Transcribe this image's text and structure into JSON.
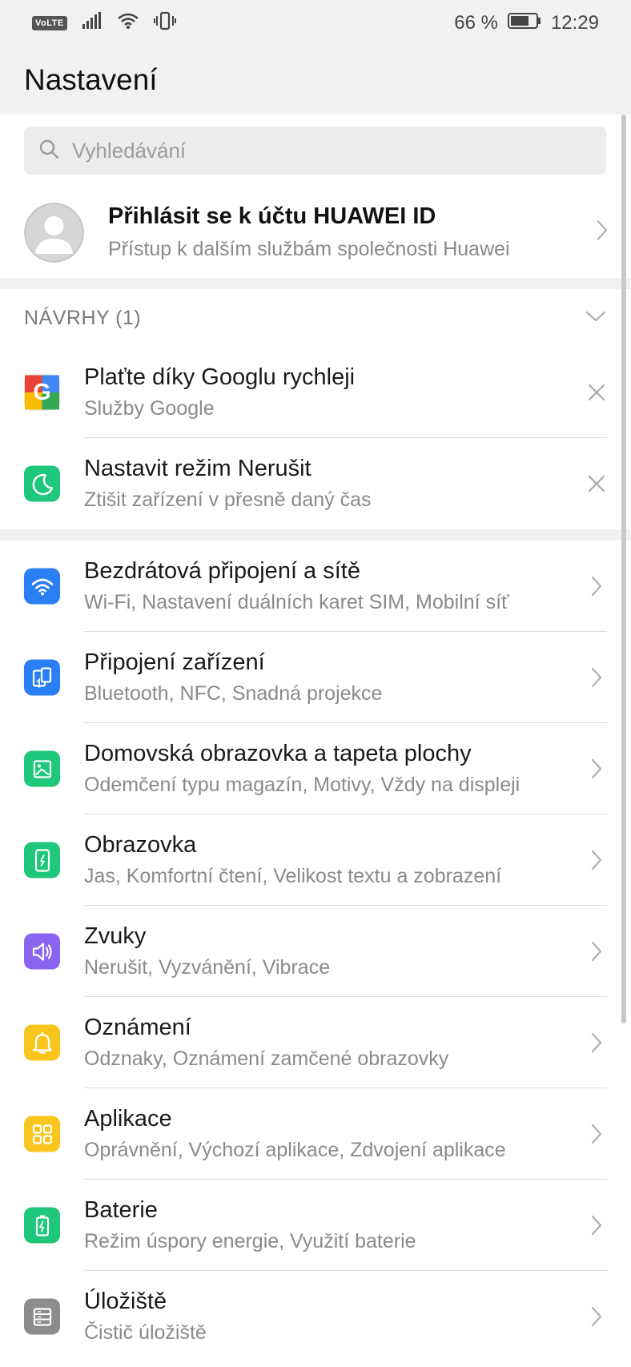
{
  "status_bar": {
    "volte": "VoLTE",
    "battery_percent": "66 %",
    "time": "12:29"
  },
  "header": {
    "title": "Nastavení"
  },
  "search": {
    "placeholder": "Vyhledávání"
  },
  "account": {
    "title": "Přihlásit se k účtu HUAWEI ID",
    "subtitle": "Přístup k dalším službám společnosti Huawei"
  },
  "suggestions": {
    "title": "NÁVRHY (1)",
    "items": [
      {
        "title": "Plaťte díky Googlu rychleji",
        "subtitle": "Služby Google",
        "icon": "google-icon"
      },
      {
        "title": "Nastavit režim Nerušit",
        "subtitle": "Ztišit zařízení v přesně daný čas",
        "icon": "moon-icon"
      }
    ]
  },
  "settings": {
    "items": [
      {
        "title": "Bezdrátová připojení a sítě",
        "subtitle": "Wi-Fi, Nastavení duálních karet SIM, Mobilní síť",
        "icon": "wifi-icon",
        "color": "#2a7ff5"
      },
      {
        "title": "Připojení zařízení",
        "subtitle": "Bluetooth, NFC, Snadná projekce",
        "icon": "device-connection-icon",
        "color": "#2a7ff5"
      },
      {
        "title": "Domovská obrazovka a tapeta plochy",
        "subtitle": "Odemčení typu magazín, Motivy, Vždy na displeji",
        "icon": "wallpaper-icon",
        "color": "#1fc77a"
      },
      {
        "title": "Obrazovka",
        "subtitle": "Jas, Komfortní čtení, Velikost textu a zobrazení",
        "icon": "display-icon",
        "color": "#1fc77a"
      },
      {
        "title": "Zvuky",
        "subtitle": "Nerušit, Vyzvánění, Vibrace",
        "icon": "speaker-icon",
        "color": "#8a63f0"
      },
      {
        "title": "Oznámení",
        "subtitle": "Odznaky, Oznámení zamčené obrazovky",
        "icon": "bell-icon",
        "color": "#f7c51e"
      },
      {
        "title": "Aplikace",
        "subtitle": "Oprávnění, Výchozí aplikace, Zdvojení aplikace",
        "icon": "apps-grid-icon",
        "color": "#f7c51e"
      },
      {
        "title": "Baterie",
        "subtitle": "Režim úspory energie, Využití baterie",
        "icon": "battery-icon",
        "color": "#1fc77a"
      },
      {
        "title": "Úložiště",
        "subtitle": "Čistič úložiště",
        "icon": "storage-icon",
        "color": "#8c8c8c"
      }
    ]
  },
  "colors": {
    "accent_blue": "#2a7ff5",
    "accent_green": "#1fc77a",
    "accent_purple": "#8a63f0",
    "accent_yellow": "#f7c51e",
    "accent_gray": "#8c8c8c"
  }
}
